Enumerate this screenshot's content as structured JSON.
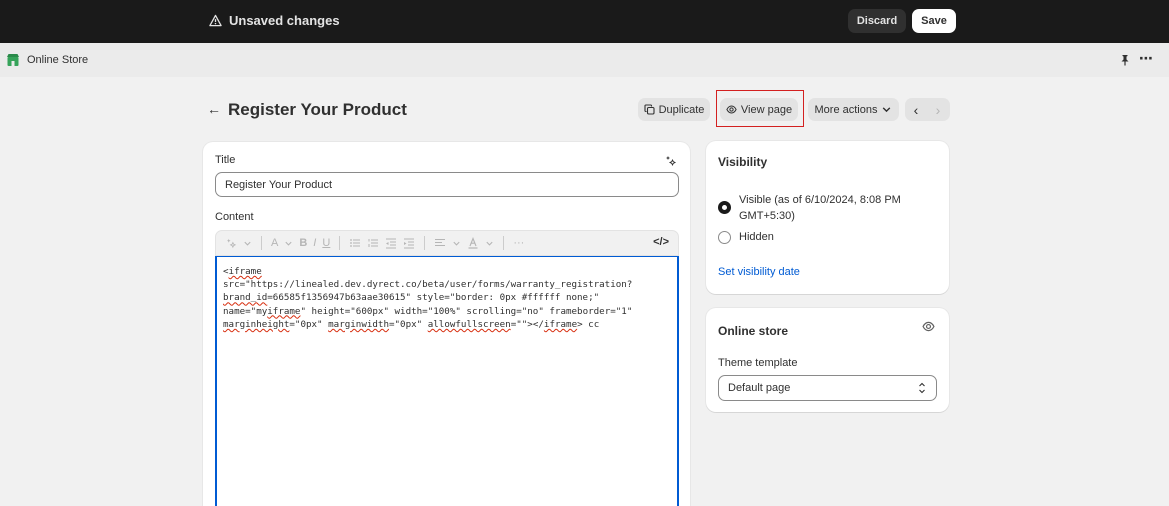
{
  "topbar": {
    "unsaved_label": "Unsaved changes",
    "discard_label": "Discard",
    "save_label": "Save"
  },
  "app": {
    "name": "Online Store",
    "more_icon": "⋯"
  },
  "page": {
    "back_arrow": "←",
    "title": "Register Your Product",
    "actions": {
      "duplicate_label": "Duplicate",
      "view_label": "View page",
      "more_label": "More actions"
    },
    "nav": {
      "prev": "‹",
      "next": "›"
    }
  },
  "editor_card": {
    "title_label": "Title",
    "title_value": "Register Your Product",
    "content_label": "Content",
    "toolbar": {
      "font_label": "A",
      "bold": "B",
      "italic": "I",
      "underline": "U",
      "more": "···",
      "code": "</>"
    },
    "code_content": "<iframe\nsrc=\"https://linealed.dev.dyrect.co/beta/user/forms/warranty_registration?\nbrand_id=66585f1356947b63aae30615\" style=\"border: 0px #ffffff none;\"\nname=\"myiframe\" height=\"600px\" width=\"100%\" scrolling=\"no\" frameborder=\"1\"\nmarginheight=\"0px\" marginwidth=\"0px\" allowfullscreen=\"\"></iframe> cc"
  },
  "visibility_card": {
    "heading": "Visibility",
    "visible_label": "Visible (as of 6/10/2024, 8:08 PM GMT+5:30)",
    "hidden_label": "Hidden",
    "link_label": "Set visibility date"
  },
  "store_card": {
    "heading": "Online store",
    "theme_label": "Theme template",
    "theme_value": "Default page"
  },
  "colors": {
    "topbar_bg": "#1a1a1a",
    "page_bg": "#f1f1f1",
    "link": "#005bd3",
    "focus": "#005bd3",
    "highlight": "#d32020"
  }
}
